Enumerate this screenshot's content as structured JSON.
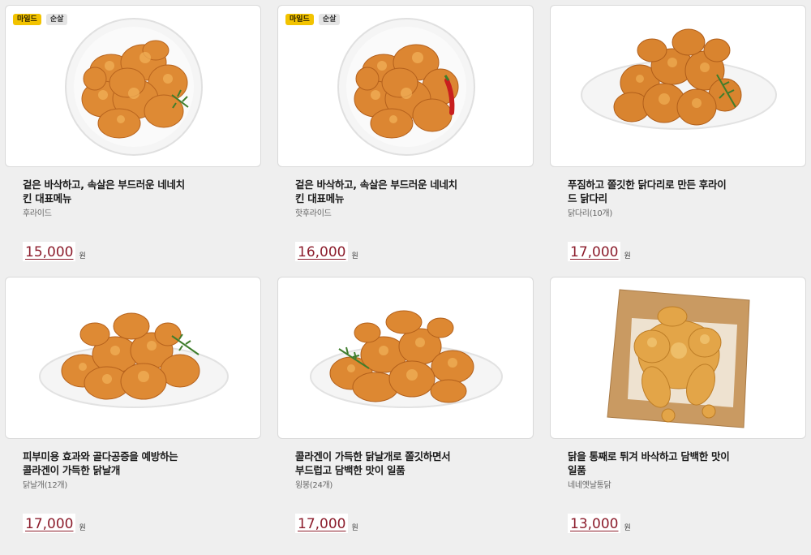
{
  "products": [
    {
      "badges": [
        "마일드",
        "순살"
      ],
      "desc": "겉은 바삭하고, 속살은 부드러운 네네치킨 대표메뉴",
      "name": "후라이드",
      "price": "15,000",
      "unit": "원",
      "image_icon": "fried-chicken-plate-icon"
    },
    {
      "badges": [
        "마일드",
        "순살"
      ],
      "desc": "겉은 바삭하고, 속살은 부드러운 네네치킨 대표메뉴",
      "name": "핫후라이드",
      "price": "16,000",
      "unit": "원",
      "image_icon": "hot-fried-chicken-plate-icon"
    },
    {
      "badges": [],
      "desc": "푸짐하고 쫄깃한 닭다리로 만든 후라이드 닭다리",
      "name": "닭다리(10개)",
      "price": "17,000",
      "unit": "원",
      "image_icon": "drumsticks-plate-icon"
    },
    {
      "badges": [],
      "desc": "피부미용 효과와 골다공증을 예방하는 콜라겐이 가득한 닭날개",
      "name": "닭날개(12개)",
      "price": "17,000",
      "unit": "원",
      "image_icon": "wings-plate-icon"
    },
    {
      "badges": [],
      "desc": "콜라겐이 가득한 닭날개로 쫄깃하면서 부드럽고 담백한 맛이 일품",
      "name": "윙봉(24개)",
      "price": "17,000",
      "unit": "원",
      "image_icon": "wingbong-plate-icon"
    },
    {
      "badges": [],
      "desc": "닭을 통째로 튀겨 바삭하고 담백한 맛이 일품",
      "name": "네네옛날통닭",
      "price": "13,000",
      "unit": "원",
      "image_icon": "whole-chicken-board-icon"
    }
  ],
  "colors": {
    "price": "#8c1d2c",
    "badge_mild": "#f2c300",
    "badge_boneless": "#e4e4e4",
    "chicken": "#e08a2e"
  }
}
